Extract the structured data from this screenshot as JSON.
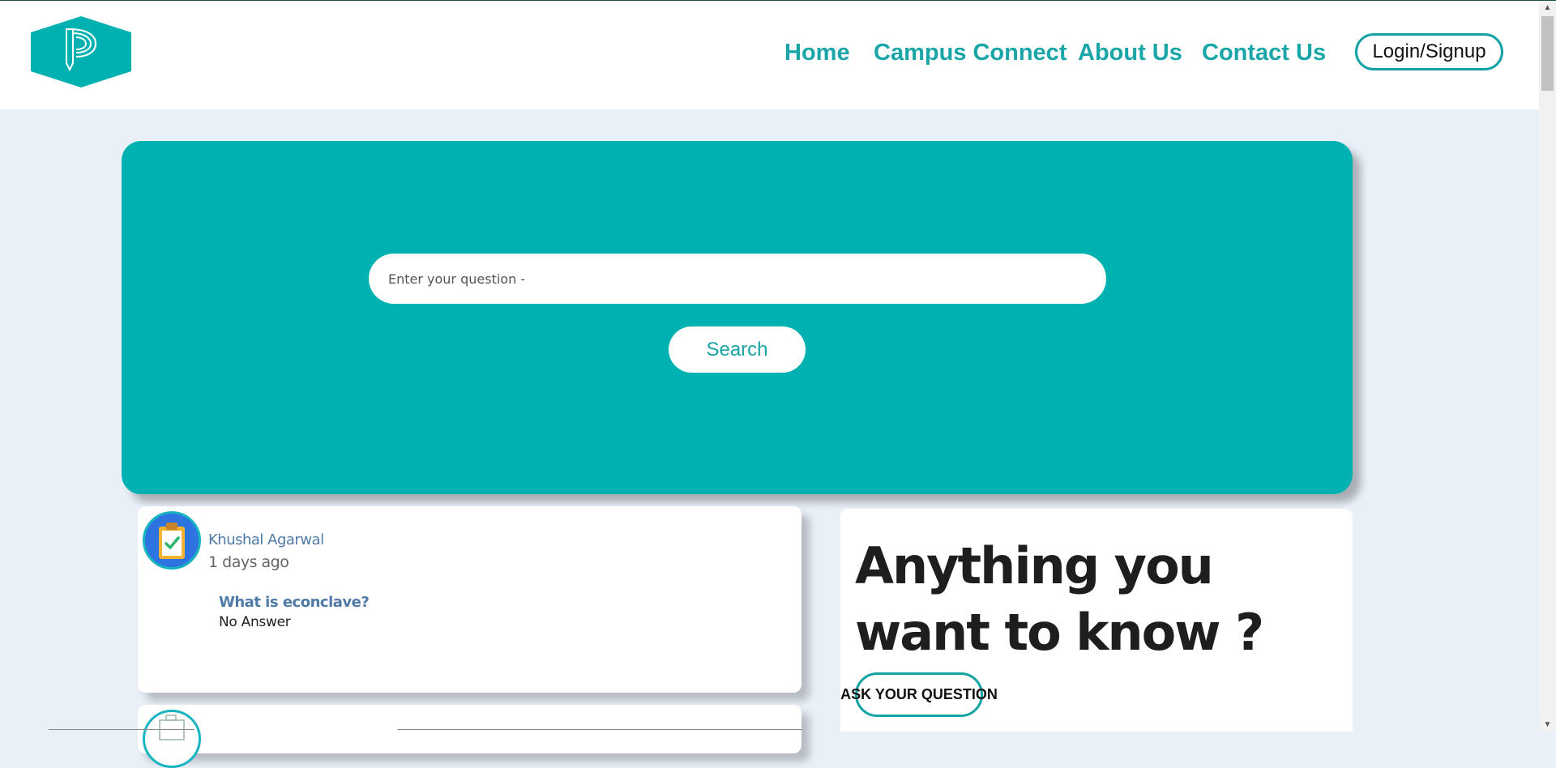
{
  "header": {
    "logo_icon": "pen-hexagon-logo-icon",
    "nav": [
      {
        "label": "Home"
      },
      {
        "label": "Campus Connect"
      },
      {
        "label": "About Us"
      },
      {
        "label": "Contact Us"
      }
    ],
    "login_label": "Login/Signup"
  },
  "hero": {
    "search_placeholder": "Enter your question -",
    "search_label": "Search"
  },
  "questions": [
    {
      "author": "Khushal Agarwal",
      "time": "1 days ago",
      "title": "What is econclave?",
      "answer": "No Answer",
      "avatar_icon": "clipboard-check-icon"
    }
  ],
  "ask_panel": {
    "title": "Anything you want to know ?",
    "button_label": "ASK YOUR QUESTION"
  },
  "colors": {
    "accent": "#00b1b2",
    "nav_text": "#1aa6a8",
    "page_bg": "#e9f0f8"
  }
}
